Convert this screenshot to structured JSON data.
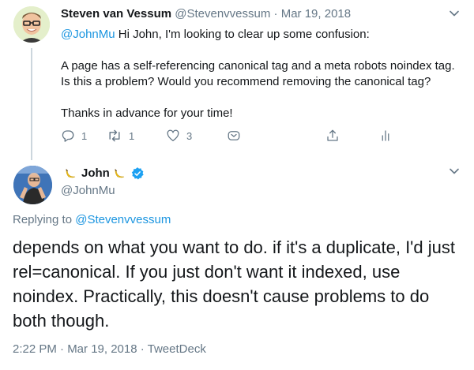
{
  "tweet1": {
    "name": "Steven van Vessum",
    "handle": "@Stevenvvessum",
    "separator": " · ",
    "date": "Mar 19, 2018",
    "mention": "@JohnMu",
    "line1_rest": " Hi John, I'm looking to clear up some confusion:",
    "paragraph2": "A page has a self-referencing canonical tag and a meta robots noindex tag. Is this a problem? Would you recommend removing the canonical tag?",
    "paragraph3": "Thanks in advance for your time!",
    "actions": {
      "reply_count": "1",
      "retweet_count": "1",
      "like_count": "3"
    }
  },
  "tweet2": {
    "name": "John",
    "verified": true,
    "handle": "@JohnMu",
    "replying_prefix": "Replying to ",
    "replying_to": "@Stevenvvessum",
    "text": "depends on what you want to do. if it's a duplicate, I'd just rel=canonical. If you just don't want it indexed, use noindex. Practically, this doesn't cause problems to do both though.",
    "meta": "2:22 PM · Mar 19, 2018 · TweetDeck"
  },
  "colors": {
    "text": "#14171a",
    "secondary": "#657786",
    "link": "#1b95e0",
    "verified": "#1da1f2",
    "thread_line": "#ccd6dd"
  },
  "icons": [
    "reply-icon",
    "retweet-icon",
    "like-icon",
    "dm-icon",
    "share-icon",
    "analytics-icon",
    "chevron-down-icon",
    "verified-badge-icon",
    "banana-emoji-icon"
  ]
}
